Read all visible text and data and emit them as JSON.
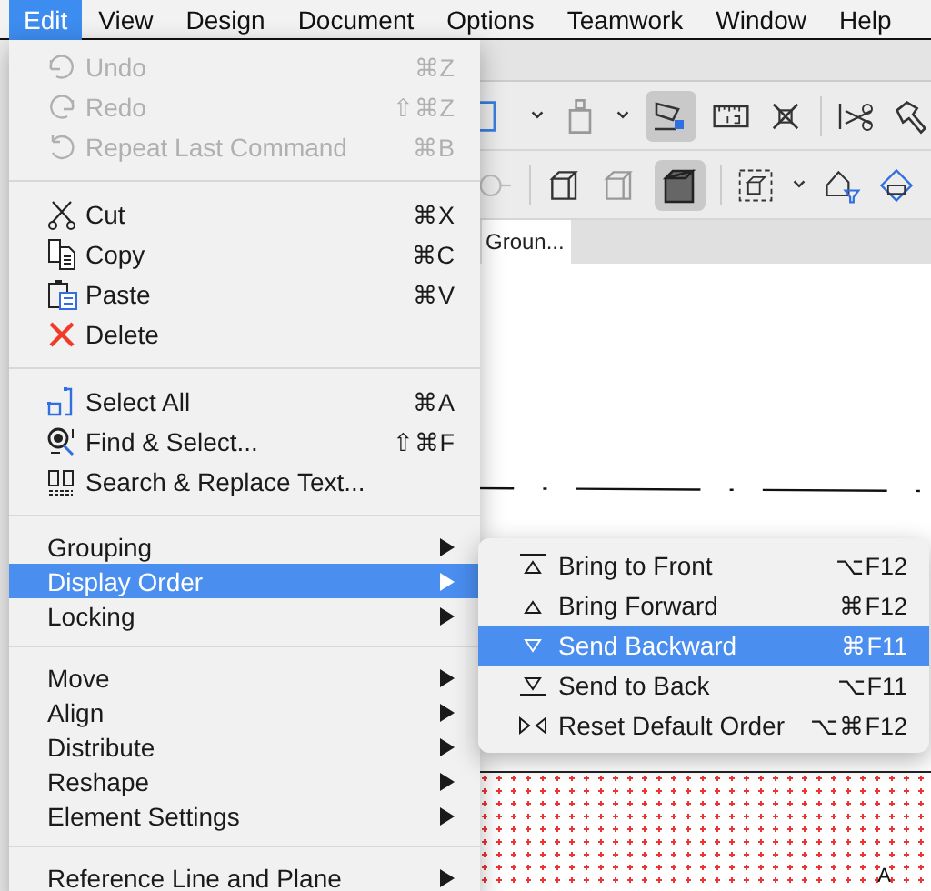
{
  "menu_bar": [
    {
      "label": "Edit",
      "selected": true
    },
    {
      "label": "View",
      "selected": false
    },
    {
      "label": "Design",
      "selected": false
    },
    {
      "label": "Document",
      "selected": false
    },
    {
      "label": "Options",
      "selected": false
    },
    {
      "label": "Teamwork",
      "selected": false
    },
    {
      "label": "Window",
      "selected": false
    },
    {
      "label": "Help",
      "selected": false
    }
  ],
  "tab": {
    "label": "Groun..."
  },
  "canvas": {
    "marker_label": "A"
  },
  "edit_menu": {
    "sections": [
      {
        "kind": "icon",
        "items": [
          {
            "label": "Undo",
            "shortcut": "⌘Z",
            "disabled": true,
            "selected": false,
            "submenu": false
          },
          {
            "label": "Redo",
            "shortcut": "⇧⌘Z",
            "disabled": true,
            "selected": false,
            "submenu": false
          },
          {
            "label": "Repeat Last Command",
            "shortcut": "⌘B",
            "disabled": true,
            "selected": false,
            "submenu": false
          }
        ]
      },
      {
        "kind": "icon",
        "items": [
          {
            "label": "Cut",
            "shortcut": "⌘X",
            "disabled": false,
            "selected": false,
            "submenu": false
          },
          {
            "label": "Copy",
            "shortcut": "⌘C",
            "disabled": false,
            "selected": false,
            "submenu": false
          },
          {
            "label": "Paste",
            "shortcut": "⌘V",
            "disabled": false,
            "selected": false,
            "submenu": false
          },
          {
            "label": "Delete",
            "disabled": false,
            "selected": false,
            "submenu": false
          }
        ]
      },
      {
        "kind": "icon",
        "items": [
          {
            "label": "Select All",
            "shortcut": "⌘A",
            "disabled": false,
            "selected": false,
            "submenu": false
          },
          {
            "label": "Find & Select...",
            "shortcut": "⇧⌘F",
            "disabled": false,
            "selected": false,
            "submenu": false
          },
          {
            "label": "Search & Replace Text...",
            "disabled": false,
            "selected": false,
            "submenu": false
          }
        ]
      },
      {
        "kind": "plain",
        "items": [
          {
            "label": "Grouping",
            "disabled": false,
            "selected": false,
            "submenu": true
          },
          {
            "label": "Display Order",
            "disabled": false,
            "selected": true,
            "submenu": true
          },
          {
            "label": "Locking",
            "disabled": false,
            "selected": false,
            "submenu": true
          }
        ]
      },
      {
        "kind": "plain",
        "items": [
          {
            "label": "Move",
            "disabled": false,
            "selected": false,
            "submenu": true
          },
          {
            "label": "Align",
            "disabled": false,
            "selected": false,
            "submenu": true
          },
          {
            "label": "Distribute",
            "disabled": false,
            "selected": false,
            "submenu": true
          },
          {
            "label": "Reshape",
            "disabled": false,
            "selected": false,
            "submenu": true
          },
          {
            "label": "Element Settings",
            "disabled": false,
            "selected": false,
            "submenu": true
          }
        ]
      },
      {
        "kind": "plain",
        "items": [
          {
            "label": "Reference Line and Plane",
            "disabled": false,
            "selected": false,
            "submenu": true
          }
        ]
      }
    ]
  },
  "display_order_submenu": [
    {
      "label": "Bring to Front",
      "shortcut": "⌥F12",
      "selected": false
    },
    {
      "label": "Bring Forward",
      "shortcut": "⌘F12",
      "selected": false
    },
    {
      "label": "Send Backward",
      "shortcut": "⌘F11",
      "selected": true
    },
    {
      "label": "Send to Back",
      "shortcut": "⌥F11",
      "selected": false
    },
    {
      "label": "Reset Default Order",
      "shortcut": "⌥⌘F12",
      "selected": false
    }
  ]
}
